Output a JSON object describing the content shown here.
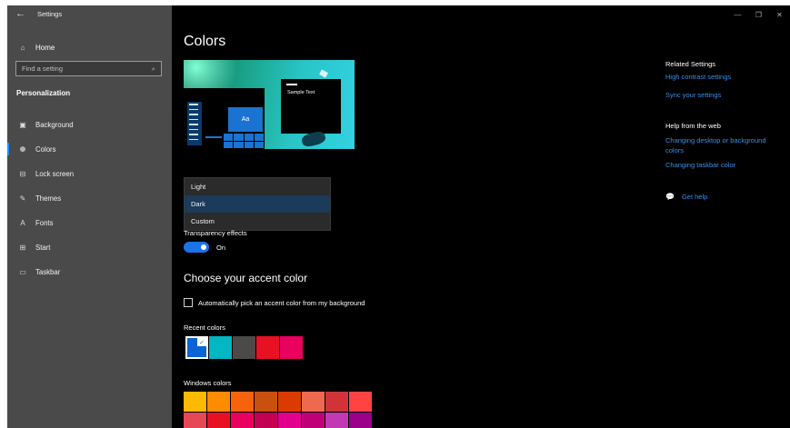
{
  "window": {
    "title": "Settings",
    "controls": [
      "minimize-icon",
      "restore-icon",
      "close-icon"
    ]
  },
  "sidebar": {
    "home_label": "Home",
    "search_placeholder": "Find a setting",
    "section_title": "Personalization",
    "items": [
      {
        "label": "Background",
        "icon": "picture-icon"
      },
      {
        "label": "Colors",
        "icon": "palette-icon",
        "active": true
      },
      {
        "label": "Lock screen",
        "icon": "lock-screen-icon"
      },
      {
        "label": "Themes",
        "icon": "brush-icon"
      },
      {
        "label": "Fonts",
        "icon": "fonts-icon"
      },
      {
        "label": "Start",
        "icon": "start-icon"
      },
      {
        "label": "Taskbar",
        "icon": "taskbar-icon"
      }
    ]
  },
  "main": {
    "title": "Colors",
    "preview_sample_text": "Sample Text",
    "preview_tile_text": "Aa",
    "mode_dropdown": {
      "options": [
        "Light",
        "Dark",
        "Custom"
      ],
      "selected": "Dark"
    },
    "transparency": {
      "label": "Transparency effects",
      "state": "On"
    },
    "accent_heading": "Choose your accent color",
    "auto_pick_label": "Automatically pick an accent color from my background",
    "recent_label": "Recent colors",
    "recent_colors": [
      "#0b63d6",
      "#00b7c3",
      "#4c4a48",
      "#e81123",
      "#ea005e"
    ],
    "windows_label": "Windows colors",
    "windows_colors": [
      "#ffb900",
      "#ff8c00",
      "#f7630c",
      "#ca5010",
      "#da3b01",
      "#ef6950",
      "#d13438",
      "#ff4343",
      "#e74856",
      "#e81123",
      "#ea005e",
      "#c30052",
      "#e3008c",
      "#bf0077",
      "#c239b3",
      "#9a0089"
    ]
  },
  "right": {
    "related_heading": "Related Settings",
    "related_links": [
      "High contrast settings",
      "Sync your settings"
    ],
    "help_heading": "Help from the web",
    "help_links": [
      "Changing desktop or background colors",
      "Changing taskbar color"
    ],
    "get_help": "Get help"
  }
}
